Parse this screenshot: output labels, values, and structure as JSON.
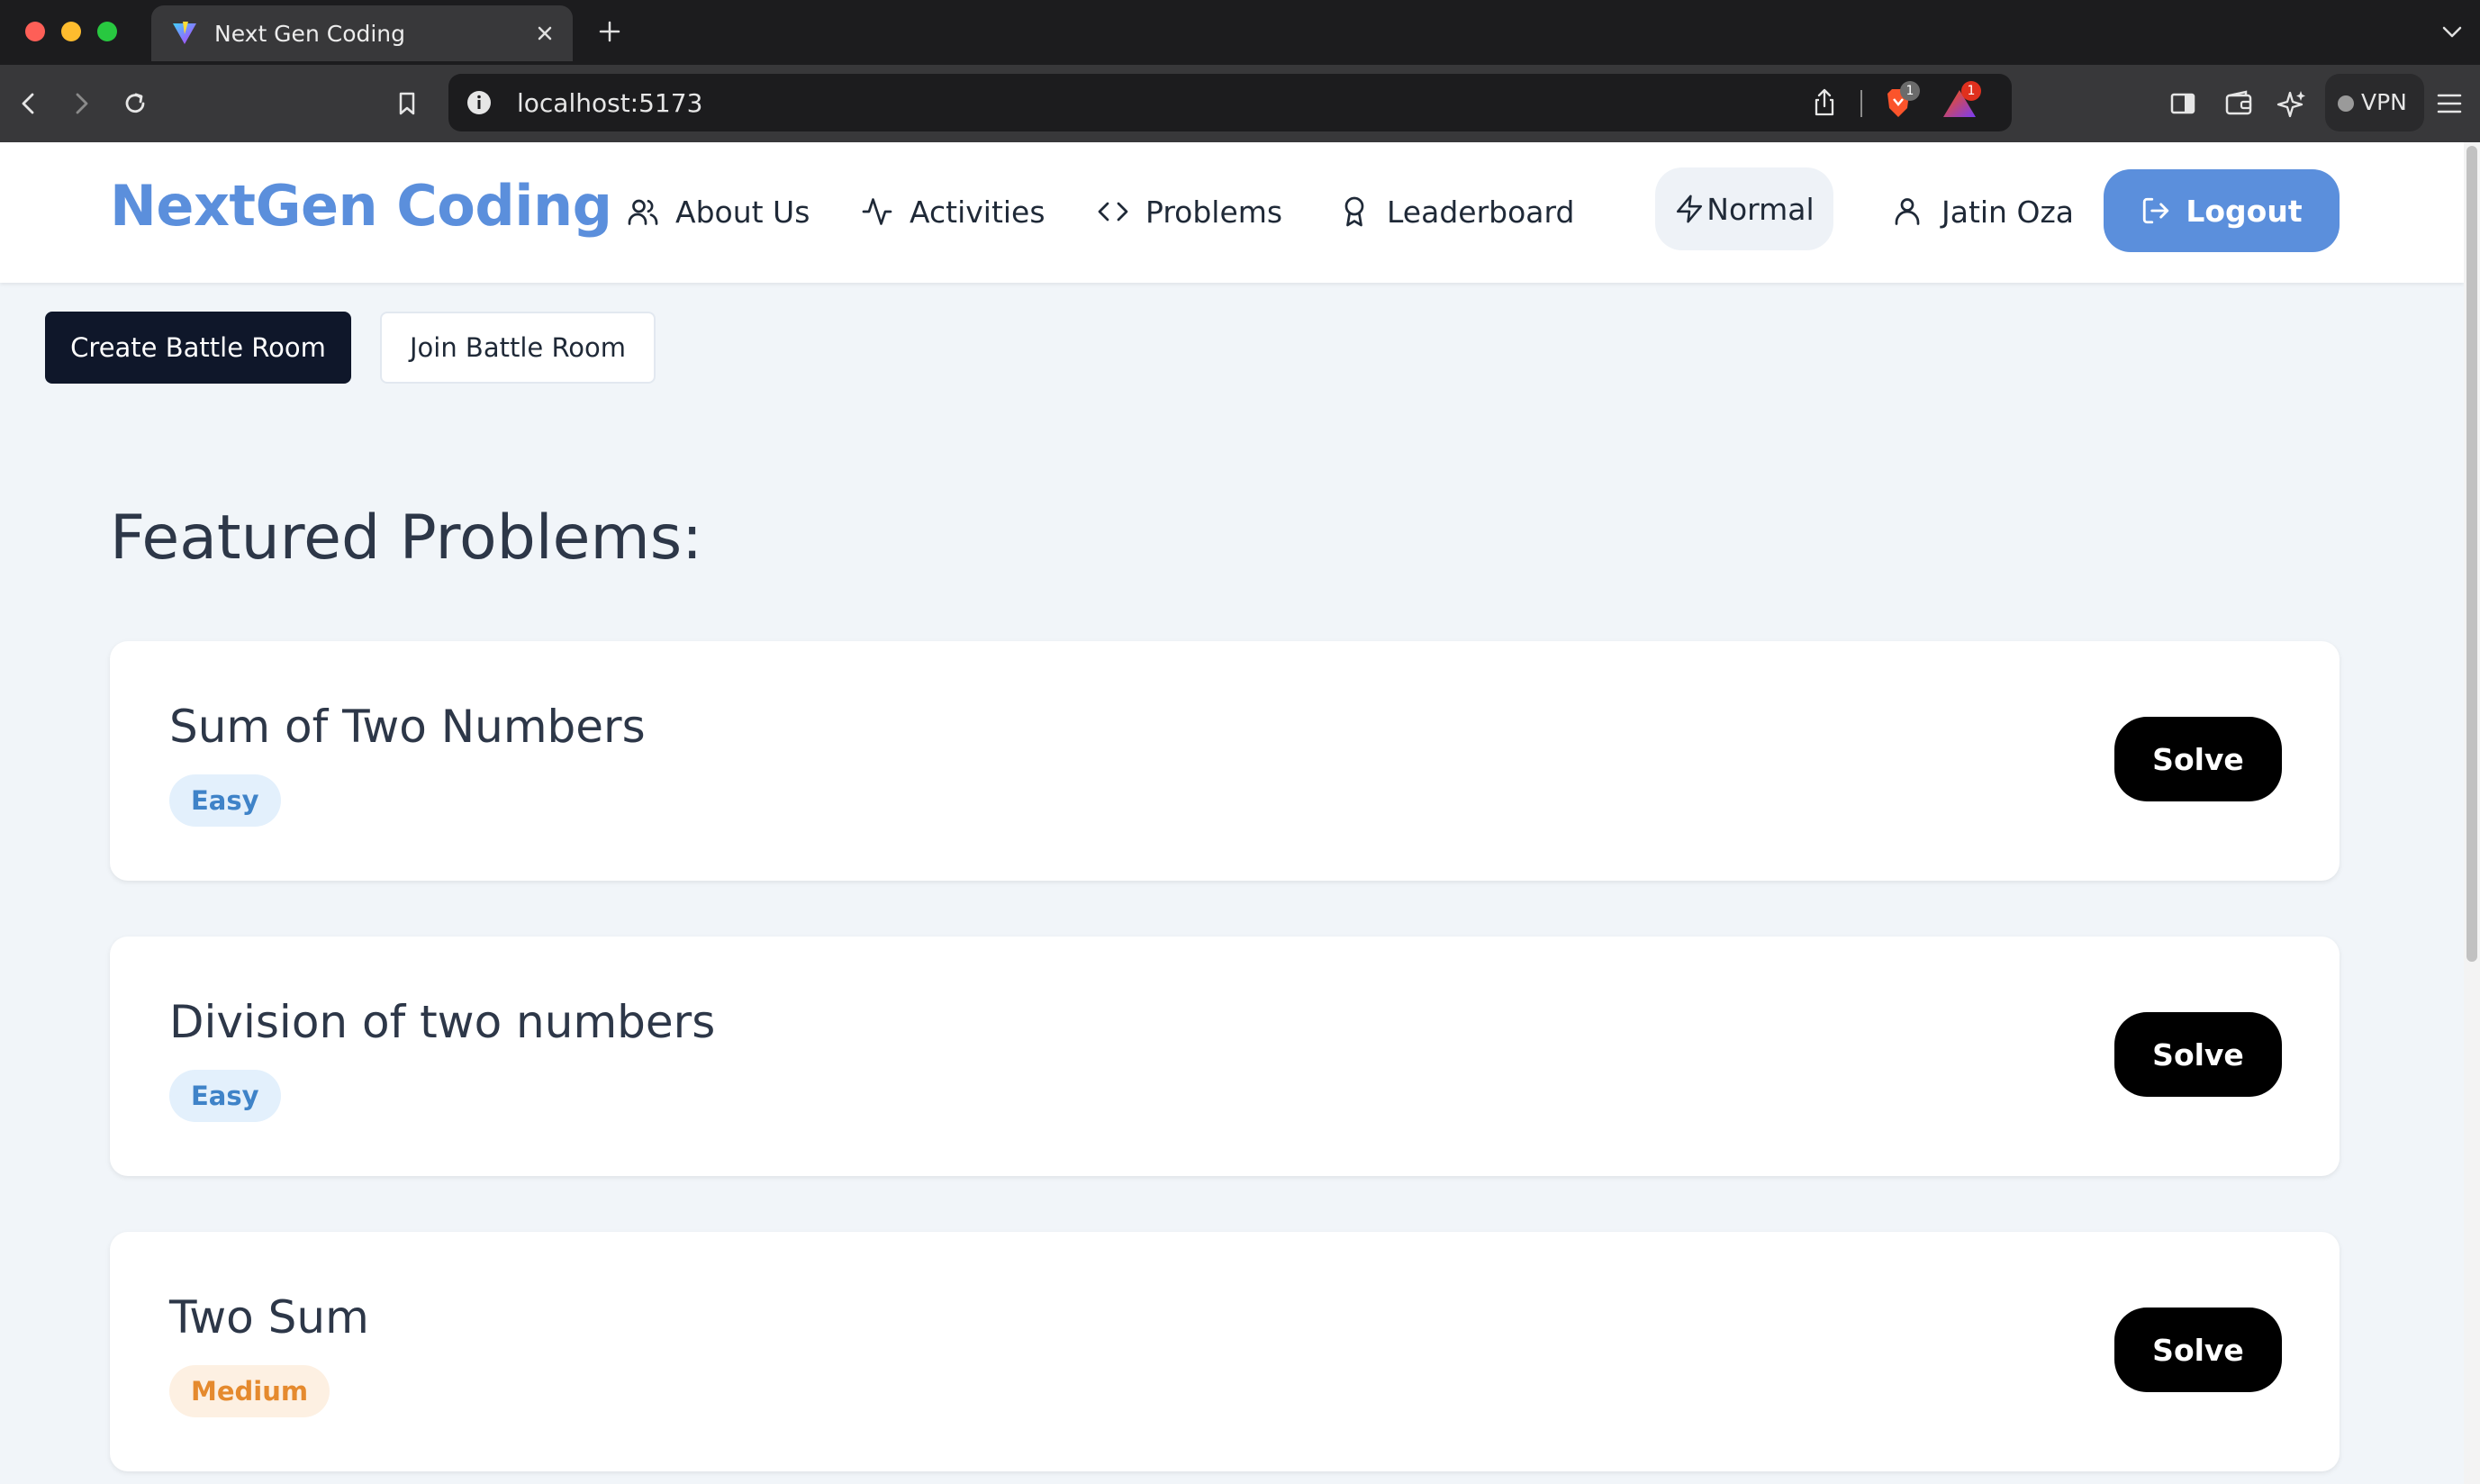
{
  "browser": {
    "tab_title": "Next Gen Coding",
    "url": "localhost:5173",
    "brave_shield_count": "1",
    "rewards_count": "1",
    "vpn_label": "VPN"
  },
  "navbar": {
    "brand": "NextGen Coding",
    "links": [
      {
        "label": "About Us",
        "icon": "users-icon"
      },
      {
        "label": "Activities",
        "icon": "activity-icon"
      },
      {
        "label": "Problems",
        "icon": "code-icon"
      },
      {
        "label": "Leaderboard",
        "icon": "award-icon"
      }
    ],
    "mode_label": "Normal",
    "user_name": "Jatin Oza",
    "logout_label": "Logout",
    "accent_color": "#5b8fdc"
  },
  "battle": {
    "create_label": "Create Battle Room",
    "join_label": "Join Battle Room"
  },
  "featured": {
    "title": "Featured Problems:",
    "problems": [
      {
        "title": "Sum of Two Numbers",
        "difficulty": "Easy",
        "action": "Solve"
      },
      {
        "title": "Division of two numbers",
        "difficulty": "Easy",
        "action": "Solve"
      },
      {
        "title": "Two Sum",
        "difficulty": "Medium",
        "action": "Solve"
      }
    ]
  },
  "colors": {
    "easy_bg": "#e3f0fc",
    "easy_text": "#3f83c8",
    "medium_bg": "#fdf0e2",
    "medium_text": "#e58a2e"
  }
}
